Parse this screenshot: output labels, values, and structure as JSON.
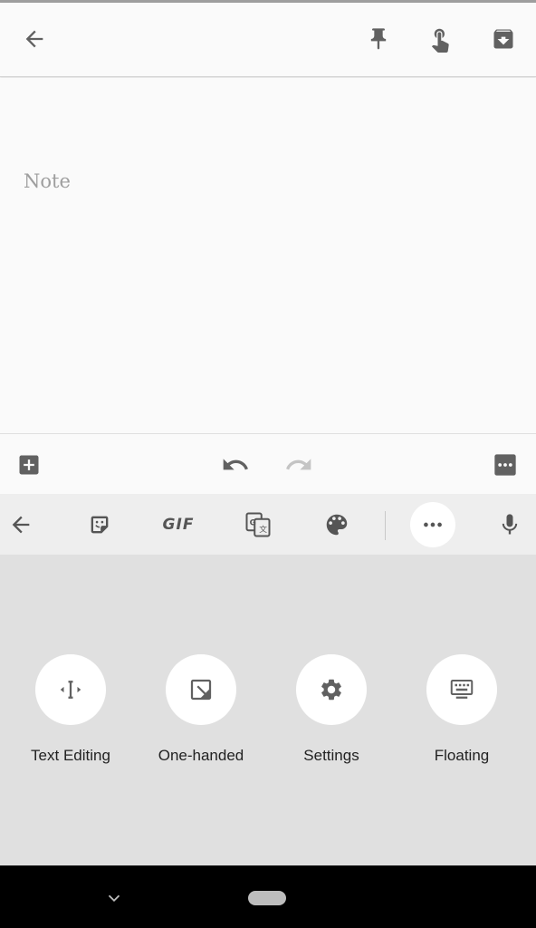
{
  "note": {
    "placeholder": "Note"
  },
  "keyboard": {
    "toolbar": {
      "gif_label": "GIF"
    },
    "options": [
      {
        "label": "Text Editing",
        "icon": "text-cursor-icon"
      },
      {
        "label": "One-handed",
        "icon": "one-handed-icon"
      },
      {
        "label": "Settings",
        "icon": "gear-icon"
      },
      {
        "label": "Floating",
        "icon": "floating-keyboard-icon"
      }
    ]
  },
  "colors": {
    "icon": "#616161",
    "panel": "#e0e0e0",
    "toolbar": "#eeeeee",
    "navbar": "#000000"
  }
}
